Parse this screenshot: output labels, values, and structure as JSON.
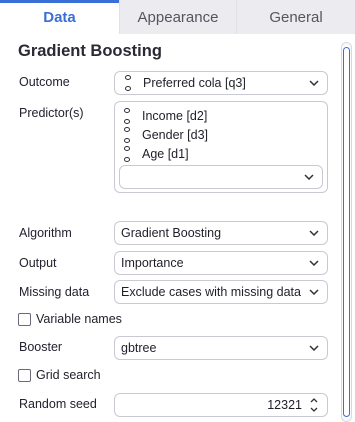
{
  "tabs": [
    {
      "label": "Data",
      "active": true
    },
    {
      "label": "Appearance",
      "active": false
    },
    {
      "label": "General",
      "active": false
    }
  ],
  "panel": {
    "title": "Gradient Boosting"
  },
  "outcome": {
    "label": "Outcome",
    "value": "Preferred cola [q3]",
    "icon": "variable-icon"
  },
  "predictors": {
    "label": "Predictor(s)",
    "items": [
      "Income [d2]",
      "Gender [d3]",
      "Age [d1]"
    ],
    "icon": "variable-icon"
  },
  "algorithm": {
    "label": "Algorithm",
    "value": "Gradient Boosting"
  },
  "output": {
    "label": "Output",
    "value": "Importance"
  },
  "missing_data": {
    "label": "Missing data",
    "value": "Exclude cases with missing data"
  },
  "variable_names": {
    "label": "Variable names",
    "checked": false
  },
  "booster": {
    "label": "Booster",
    "value": "gbtree"
  },
  "grid_search": {
    "label": "Grid search",
    "checked": false
  },
  "random_seed": {
    "label": "Random seed",
    "value": "12321"
  },
  "colors": {
    "accent": "#3a6fd8",
    "border": "#c9c9d3"
  }
}
